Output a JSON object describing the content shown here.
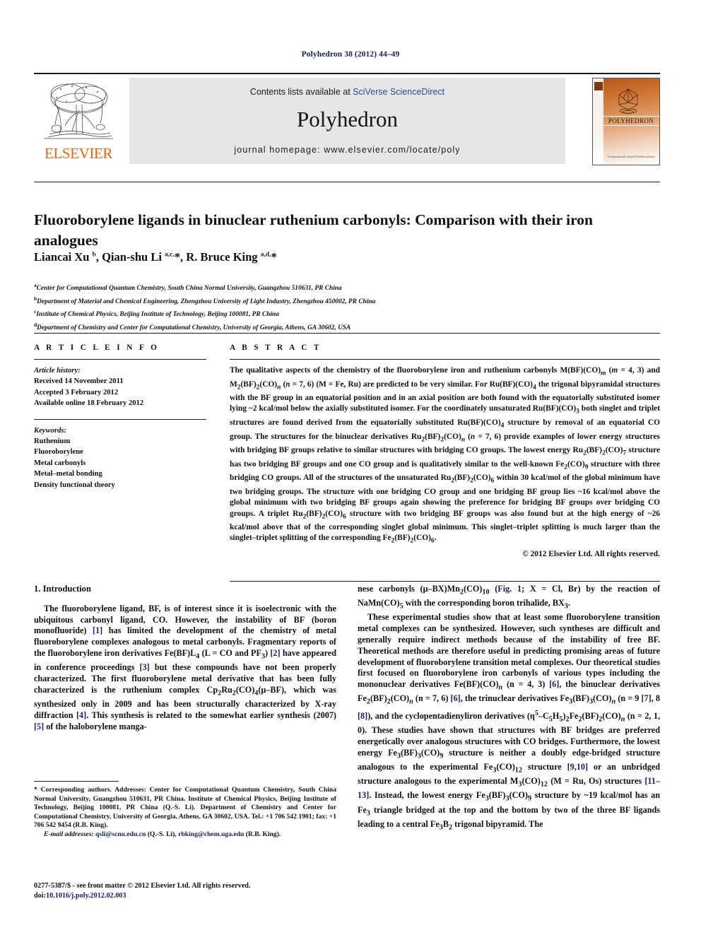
{
  "running_head": "Polyhedron 38 (2012) 44–49",
  "header": {
    "contents_prefix": "Contents lists available at ",
    "contents_link": "SciVerse ScienceDirect",
    "journal_name": "Polyhedron",
    "homepage": "journal homepage: www.elsevier.com/locate/poly",
    "publisher_wordmark": "ELSEVIER",
    "cover_title": "POLYHEDRON",
    "cover_footer": "An International Journal\nMultidisciplinary"
  },
  "article": {
    "title": "Fluoroborylene ligands in binuclear ruthenium carbonyls: Comparison with their iron analogues",
    "authors_html": "Liancai Xu <sup>b</sup>, Qian-shu Li <sup>a,c,</sup>*, R. Bruce King <sup>a,d,</sup>*",
    "affiliations": [
      {
        "mark": "a",
        "text": "Center for Computational Quantum Chemistry, South China Normal University, Guangzhou 510631, PR China"
      },
      {
        "mark": "b",
        "text": "Department of Material and Chemical Engineering, Zhengzhou University of Light Industry, Zhengzhou 450002, PR China"
      },
      {
        "mark": "c",
        "text": "Institute of Chemical Physics, Beijing Institute of Technology, Beijing 100081, PR China"
      },
      {
        "mark": "d",
        "text": "Department of Chemistry and Center for Computational Chemistry, University of Georgia, Athens, GA 30602, USA"
      }
    ]
  },
  "article_info": {
    "heading": "A R T I C L E   I N F O",
    "history_label": "Article history:",
    "history": [
      "Received 14 November 2011",
      "Accepted 3 February 2012",
      "Available online 18 February 2012"
    ],
    "keywords_label": "Keywords:",
    "keywords": [
      "Ruthenium",
      "Fluoroborylene",
      "Metal carbonyls",
      "Metal–metal bonding",
      "Density functional theory"
    ]
  },
  "abstract": {
    "heading": "A B S T R A C T",
    "body_html": "The qualitative aspects of the chemistry of the fluoroborylene iron and ruthenium carbonyls M(BF)(CO)<sub><i>m</i></sub> (<i>m</i> = 4, 3) and M<sub>2</sub>(BF)<sub>2</sub>(CO)<sub><i>n</i></sub> (<i>n</i> = 7, 6) (M = Fe, Ru) are predicted to be very similar. For Ru(BF)(CO)<sub>4</sub> the trigonal bipyramidal structures with the BF group in an equatorial position and in an axial position are both found with the equatorially substituted isomer lying ~2 kcal/mol below the axially substituted isomer. For the coordinately unsaturated Ru(BF)(CO)<sub>3</sub> both singlet and triplet structures are found derived from the equatorially substituted Ru(BF)(CO)<sub>4</sub> structure by removal of an equatorial CO group. The structures for the binuclear derivatives Ru<sub>2</sub>(BF)<sub>2</sub>(CO)<sub><i>n</i></sub> (<i>n</i> = 7, 6) provide examples of lower energy structures with bridging BF groups relative to similar structures with bridging CO groups. The lowest energy Ru<sub>2</sub>(BF)<sub>2</sub>(CO)<sub>7</sub> structure has two bridging BF groups and one CO group and is qualitatively similar to the well-known Fe<sub>2</sub>(CO)<sub>9</sub> structure with three bridging CO groups. All of the structures of the unsaturated Ru<sub>2</sub>(BF)<sub>2</sub>(CO)<sub>6</sub> within 30 kcal/mol of the global minimum have two bridging groups. The structure with one bridging CO group and one bridging BF group lies ~16 kcal/mol above the global minimum with two bridging BF groups again showing the preference for bridging BF groups over bridging CO groups. A triplet Ru<sub>2</sub>(BF)<sub>2</sub>(CO)<sub>6</sub> structure with two bridging BF groups was also found but at the high energy of ~26 kcal/mol above that of the corresponding singlet global minimum. This singlet–triplet splitting is much larger than the singlet–triplet splitting of the corresponding Fe<sub>2</sub>(BF)<sub>2</sub>(CO)<sub>6</sub>.",
    "copyright": "© 2012 Elsevier Ltd. All rights reserved."
  },
  "body": {
    "section_title": "1. Introduction",
    "left_paragraphs_html": [
      "The fluoroborylene ligand, BF, is of interest since it is isoelectronic with the ubiquitous carbonyl ligand, CO. However, the instability of BF (boron monofluoride) <span class=\"ref\">[1]</span> has limited the development of the chemistry of metal fluoroborylene complexes analogous to metal carbonyls. Fragmentary reports of the fluoroborylene iron derivatives Fe(BF)L<sub>4</sub> (L = CO and PF<sub>3</sub>) <span class=\"ref\">[2]</span> have appeared in conference proceedings <span class=\"ref\">[3]</span> but these compounds have not been properly characterized. The first fluoroborylene metal derivative that has been fully characterized is the ruthenium complex Cp<sub>2</sub>Ru<sub>2</sub>(CO)<sub>4</sub>(μ–BF), which was synthesized only in 2009 and has been structurally characterized by X-ray diffraction <span class=\"ref\">[4]</span>. This synthesis is related to the somewhat earlier synthesis (2007) <span class=\"ref\">[5]</span> of the haloborylene manga-"
    ],
    "right_paragraphs_html": [
      "nese carbonyls (μ–BX)Mn<sub>2</sub>(CO)<sub>10</sub> (<span class=\"ref\">Fig. 1</span>; X = Cl, Br) by the reaction of NaMn(CO)<sub>5</sub> with the corresponding boron trihalide, BX<sub>3</sub>.",
      "These experimental studies show that at least some fluoroborylene transition metal complexes can be synthesized. However, such syntheses are difficult and generally require indirect methods because of the instability of free BF. Theoretical methods are therefore useful in predicting promising areas of future development of fluoroborylene transition metal complexes. Our theoretical studies first focused on fluoroborylene iron carbonyls of various types including the mononuclear derivatives Fe(BF)(CO)<sub><i>n</i></sub> (n = 4, 3) <span class=\"ref\">[6]</span>, the binuclear derivatives Fe<sub>2</sub>(BF)<sub>2</sub>(CO)<sub><i>n</i></sub> (n = 7, 6) <span class=\"ref\">[6]</span>, the trinuclear derivatives Fe<sub>3</sub>(BF)<sub>3</sub>(CO)<sub><i>n</i></sub> (n = 9 <span class=\"ref\">[7]</span>, 8 <span class=\"ref\">[8]</span>), and the cyclopentadienyliron derivatives (η<sup>5</sup>–C<sub>5</sub>H<sub>5</sub>)<sub>2</sub>Fe<sub>2</sub>(BF)<sub>2</sub>(CO)<sub><i>n</i></sub> (n = 2, 1, 0). These studies have shown that structures with BF bridges are preferred energetically over analogous structures with CO bridges. Furthermore, the lowest energy Fe<sub>3</sub>(BF)<sub>3</sub>(CO)<sub>9</sub> structure is neither a doubly edge-bridged structure analogous to the experimental Fe<sub>3</sub>(CO)<sub>12</sub> structure <span class=\"ref\">[9,10]</span> or an unbridged structure analogous to the experimental M<sub>3</sub>(CO)<sub>12</sub> (M = Ru, Os) structures <span class=\"ref\">[11–13]</span>. Instead, the lowest energy Fe<sub>3</sub>(BF)<sub>3</sub>(CO)<sub>9</sub> structure by ~19 kcal/mol has an Fe<sub>3</sub> triangle bridged at the top and the bottom by two of the three BF ligands leading to a central Fe<sub>3</sub>B<sub>2</sub> trigonal bipyramid. The"
    ]
  },
  "footnote": {
    "corresponding_html": "* Corresponding authors. Addresses: Center for Computational Quantum Chemistry, South China Normal University, Guangzhou 510631, PR China. Institute of Chemical Physics, Beijing Institute of Technology, Beijing 100081, PR China (Q.-S. Li). Department of Chemistry and Center for Computational Chemistry, University of Georgia, Athens, GA 30602, USA. Tel.: +1 706 542 1901; fax: +1 706 542 9454 (R.B. King).",
    "email_html": "<span class=\"em\">E-mail addresses:</span> <span class=\"ref\">qsli@scnu.edu.cn</span> (Q.-S. Li), <span class=\"ref\">rbking@chem.uga.edu</span> (R.B. King)."
  },
  "imprint": {
    "issn_line": "0277-5387/$ - see front matter © 2012 Elsevier Ltd. All rights reserved.",
    "doi_prefix": "doi:",
    "doi_value": "10.1016/j.poly.2012.02.003"
  },
  "colors": {
    "link_blue": "#2c4b9b",
    "ref_blue": "#16205e",
    "elsevier_orange": "#eb6608",
    "band_gray": "#e6e6e6"
  }
}
